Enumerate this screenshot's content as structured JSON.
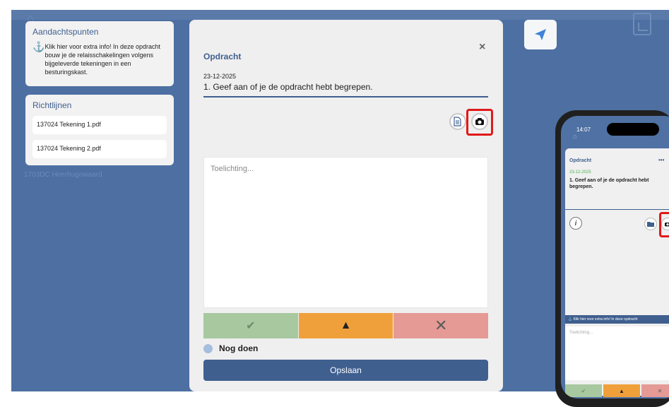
{
  "sidebar": {
    "attention_title": "Aandachtspunten",
    "attention_text": "Klik hier voor extra info! In deze opdracht bouw je de relaisschakelingen volgens bijgeleverde tekeningen in een besturingskast.",
    "guidelines_title": "Richtlijnen",
    "pdfs": [
      "137024 Tekening 1.pdf",
      "137024 Tekening 2.pdf"
    ],
    "background_text": "1703DC Heerhugowaard"
  },
  "modal": {
    "title": "Opdracht",
    "close_label": "×",
    "date": "23-12-2025",
    "question": "1. Geef aan of je de opdracht hebt begrepen.",
    "placeholder": "Toelichting...",
    "status_label": "Nog doen",
    "save_label": "Opslaan",
    "status_buttons": [
      "✔",
      "▲",
      "✕"
    ]
  },
  "phone": {
    "time": "14:07",
    "title": "Opdracht",
    "more": "•••",
    "date": "23-12-2025",
    "question": "1. Geef aan of je de opdracht hebt begrepen.",
    "info": "i",
    "banner": "Klik hier voor extra info! In deze opdracht",
    "placeholder": "Toelichting...",
    "status_buttons": [
      "✔",
      "▲",
      "✕"
    ]
  },
  "colors": {
    "app_bg": "#4d6fa2",
    "accent": "#3f5f8f",
    "ok": "#a8c8a0",
    "warn": "#f0a03a",
    "no": "#e59a95",
    "highlight": "#e21919"
  },
  "icons": [
    "home-icon",
    "report-icon",
    "send-icon",
    "anchor-icon",
    "file-icon",
    "camera-icon",
    "close-icon",
    "check-icon",
    "warning-icon",
    "x-icon",
    "info-icon",
    "folder-icon"
  ]
}
